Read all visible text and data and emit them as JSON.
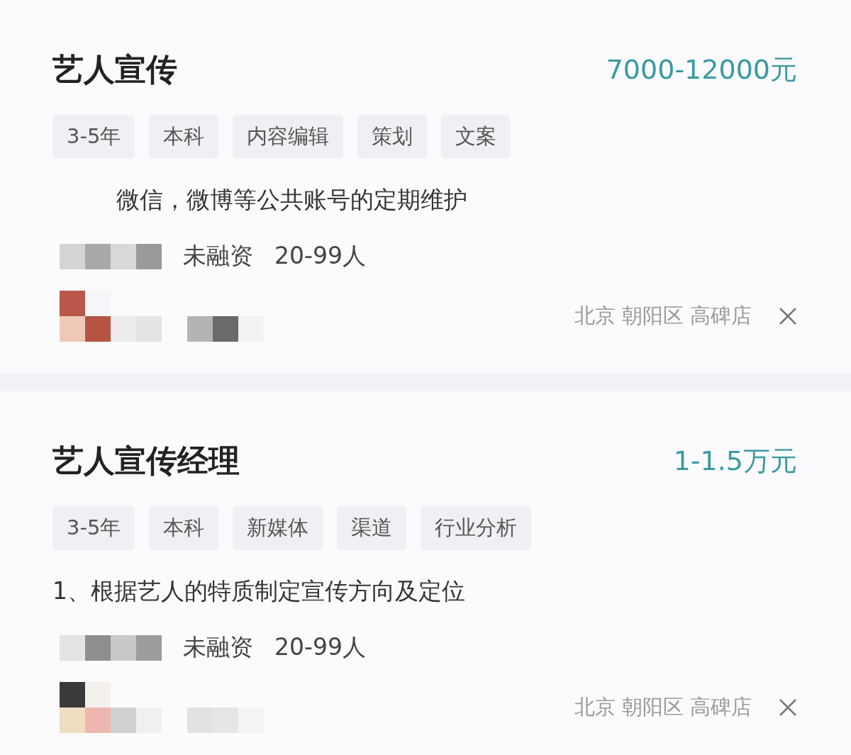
{
  "jobs": [
    {
      "title": "艺人宣传",
      "salary": "7000-12000元",
      "tags": [
        "3-5年",
        "本科",
        "内容编辑",
        "策划",
        "文案"
      ],
      "description": "微信，微博等公共账号的定期维护",
      "indented": true,
      "funding": "未融资",
      "size": "20-99人",
      "location": "北京 朝阳区 高碑店"
    },
    {
      "title": "艺人宣传经理",
      "salary": "1-1.5万元",
      "tags": [
        "3-5年",
        "本科",
        "新媒体",
        "渠道",
        "行业分析"
      ],
      "description": "1、根据艺人的特质制定宣传方向及定位",
      "indented": false,
      "funding": "未融资",
      "size": "20-99人",
      "location": "北京 朝阳区 高碑店"
    }
  ]
}
